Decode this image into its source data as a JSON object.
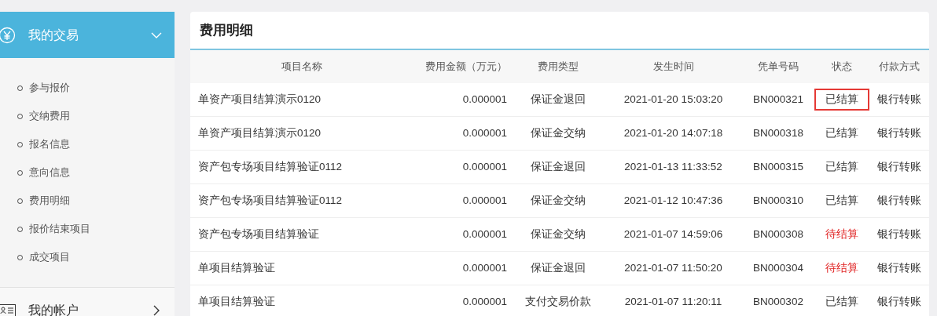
{
  "sidebar": {
    "groups": [
      {
        "title": "我的交易",
        "expanded": true,
        "items": [
          {
            "label": "参与报价"
          },
          {
            "label": "交纳费用"
          },
          {
            "label": "报名信息"
          },
          {
            "label": "意向信息"
          },
          {
            "label": "费用明细"
          },
          {
            "label": "报价结束项目"
          },
          {
            "label": "成交项目"
          }
        ]
      },
      {
        "title": "我的帐户",
        "expanded": false
      }
    ]
  },
  "panel": {
    "title": "费用明细",
    "table": {
      "columns": [
        "项目名称",
        "费用金额（万元）",
        "费用类型",
        "发生时间",
        "凭单号码",
        "状态",
        "付款方式"
      ],
      "rows": [
        {
          "name": "单资产项目结算演示0120",
          "amount": "0.000001",
          "type": "保证金退回",
          "time": "2021-01-20 15:03:20",
          "code": "BN000321",
          "status": "已结算",
          "pending": false,
          "highlighted": true,
          "payment": "银行转账"
        },
        {
          "name": "单资产项目结算演示0120",
          "amount": "0.000001",
          "type": "保证金交纳",
          "time": "2021-01-20 14:07:18",
          "code": "BN000318",
          "status": "已结算",
          "pending": false,
          "highlighted": false,
          "payment": "银行转账"
        },
        {
          "name": "资产包专场项目结算验证0112",
          "amount": "0.000001",
          "type": "保证金退回",
          "time": "2021-01-13 11:33:52",
          "code": "BN000315",
          "status": "已结算",
          "pending": false,
          "highlighted": false,
          "payment": "银行转账"
        },
        {
          "name": "资产包专场项目结算验证0112",
          "amount": "0.000001",
          "type": "保证金交纳",
          "time": "2021-01-12 10:47:36",
          "code": "BN000310",
          "status": "已结算",
          "pending": false,
          "highlighted": false,
          "payment": "银行转账"
        },
        {
          "name": "资产包专场项目结算验证",
          "amount": "0.000001",
          "type": "保证金交纳",
          "time": "2021-01-07 14:59:06",
          "code": "BN000308",
          "status": "待结算",
          "pending": true,
          "highlighted": false,
          "payment": "银行转账"
        },
        {
          "name": "单项目结算验证",
          "amount": "0.000001",
          "type": "保证金退回",
          "time": "2021-01-07 11:50:20",
          "code": "BN000304",
          "status": "待结算",
          "pending": true,
          "highlighted": false,
          "payment": "银行转账"
        },
        {
          "name": "单项目结算验证",
          "amount": "0.000001",
          "type": "支付交易价款",
          "time": "2021-01-07 11:20:11",
          "code": "BN000302",
          "status": "已结算",
          "pending": false,
          "highlighted": false,
          "payment": "银行转账"
        }
      ]
    }
  }
}
